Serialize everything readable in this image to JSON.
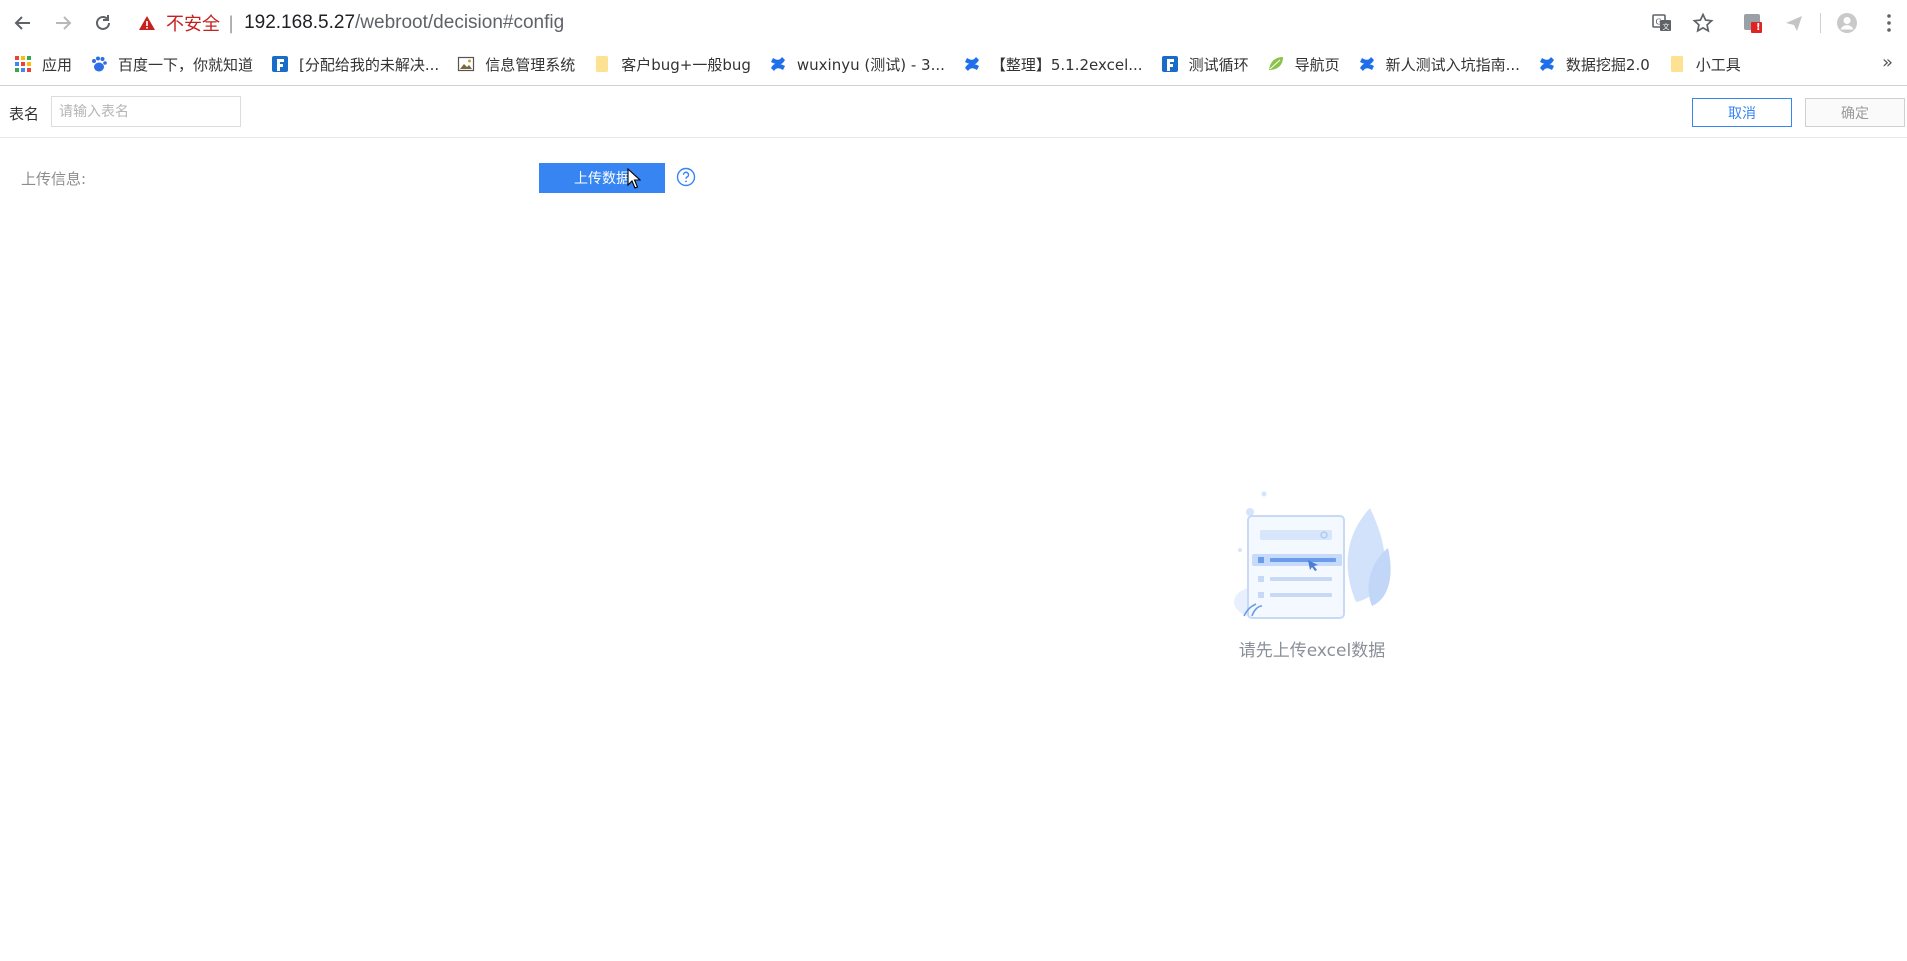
{
  "browser": {
    "security_label": "不安全",
    "separator": "|",
    "url_host": "192.168.5.27",
    "url_path": "/webroot/decision#config",
    "notification_badge": "!",
    "bookmarks": [
      {
        "label": "应用",
        "icon": "apps-grid-icon"
      },
      {
        "label": "百度一下，你就知道",
        "icon": "baidu-paw-icon"
      },
      {
        "label": "[分配给我的未解决...",
        "icon": "finereport-f-icon"
      },
      {
        "label": "信息管理系统",
        "icon": "image-icon"
      },
      {
        "label": "客户bug+一般bug",
        "icon": "folder-icon"
      },
      {
        "label": "wuxinyu (测试) - 3...",
        "icon": "confluence-icon"
      },
      {
        "label": "【整理】5.1.2excel...",
        "icon": "confluence-icon"
      },
      {
        "label": "测试循环",
        "icon": "finereport-f-icon"
      },
      {
        "label": "导航页",
        "icon": "leaf-icon"
      },
      {
        "label": "新人测试入坑指南...",
        "icon": "confluence-icon"
      },
      {
        "label": "数据挖掘2.0",
        "icon": "confluence-icon"
      },
      {
        "label": "小工具",
        "icon": "folder-icon"
      }
    ],
    "more_label": "»"
  },
  "header": {
    "table_name_label": "表名",
    "table_name_placeholder": "请输入表名",
    "table_name_value": "",
    "cancel_label": "取消",
    "confirm_label": "确定"
  },
  "upload": {
    "info_label": "上传信息:",
    "button_label": "上传数据"
  },
  "empty_state": {
    "message": "请先上传excel数据"
  },
  "colors": {
    "primary": "#3685f2",
    "insecure": "#c5221f",
    "muted_text": "#8c8c8c"
  }
}
